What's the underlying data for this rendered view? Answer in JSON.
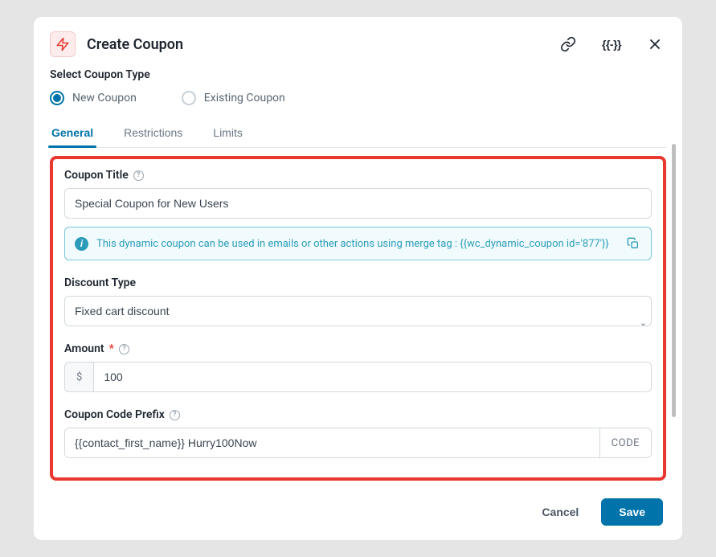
{
  "header": {
    "title": "Create Coupon"
  },
  "coupon_type": {
    "label": "Select Coupon Type",
    "options": [
      {
        "label": "New Coupon",
        "selected": true
      },
      {
        "label": "Existing Coupon",
        "selected": false
      }
    ]
  },
  "tabs": [
    {
      "label": "General",
      "active": true
    },
    {
      "label": "Restrictions",
      "active": false
    },
    {
      "label": "Limits",
      "active": false
    }
  ],
  "fields": {
    "title": {
      "label": "Coupon Title",
      "value": "Special Coupon for New Users"
    },
    "info_banner": {
      "text": "This dynamic coupon can be used in emails or other actions using merge tag : {{wc_dynamic_coupon id='877'}}"
    },
    "discount_type": {
      "label": "Discount Type",
      "value": "Fixed cart discount"
    },
    "amount": {
      "label": "Amount",
      "required_mark": "*",
      "currency": "$",
      "value": "100"
    },
    "prefix": {
      "label": "Coupon Code Prefix",
      "value": "{{contact_first_name}} Hurry100Now",
      "suffix": "CODE"
    }
  },
  "footer": {
    "cancel": "Cancel",
    "save": "Save"
  }
}
